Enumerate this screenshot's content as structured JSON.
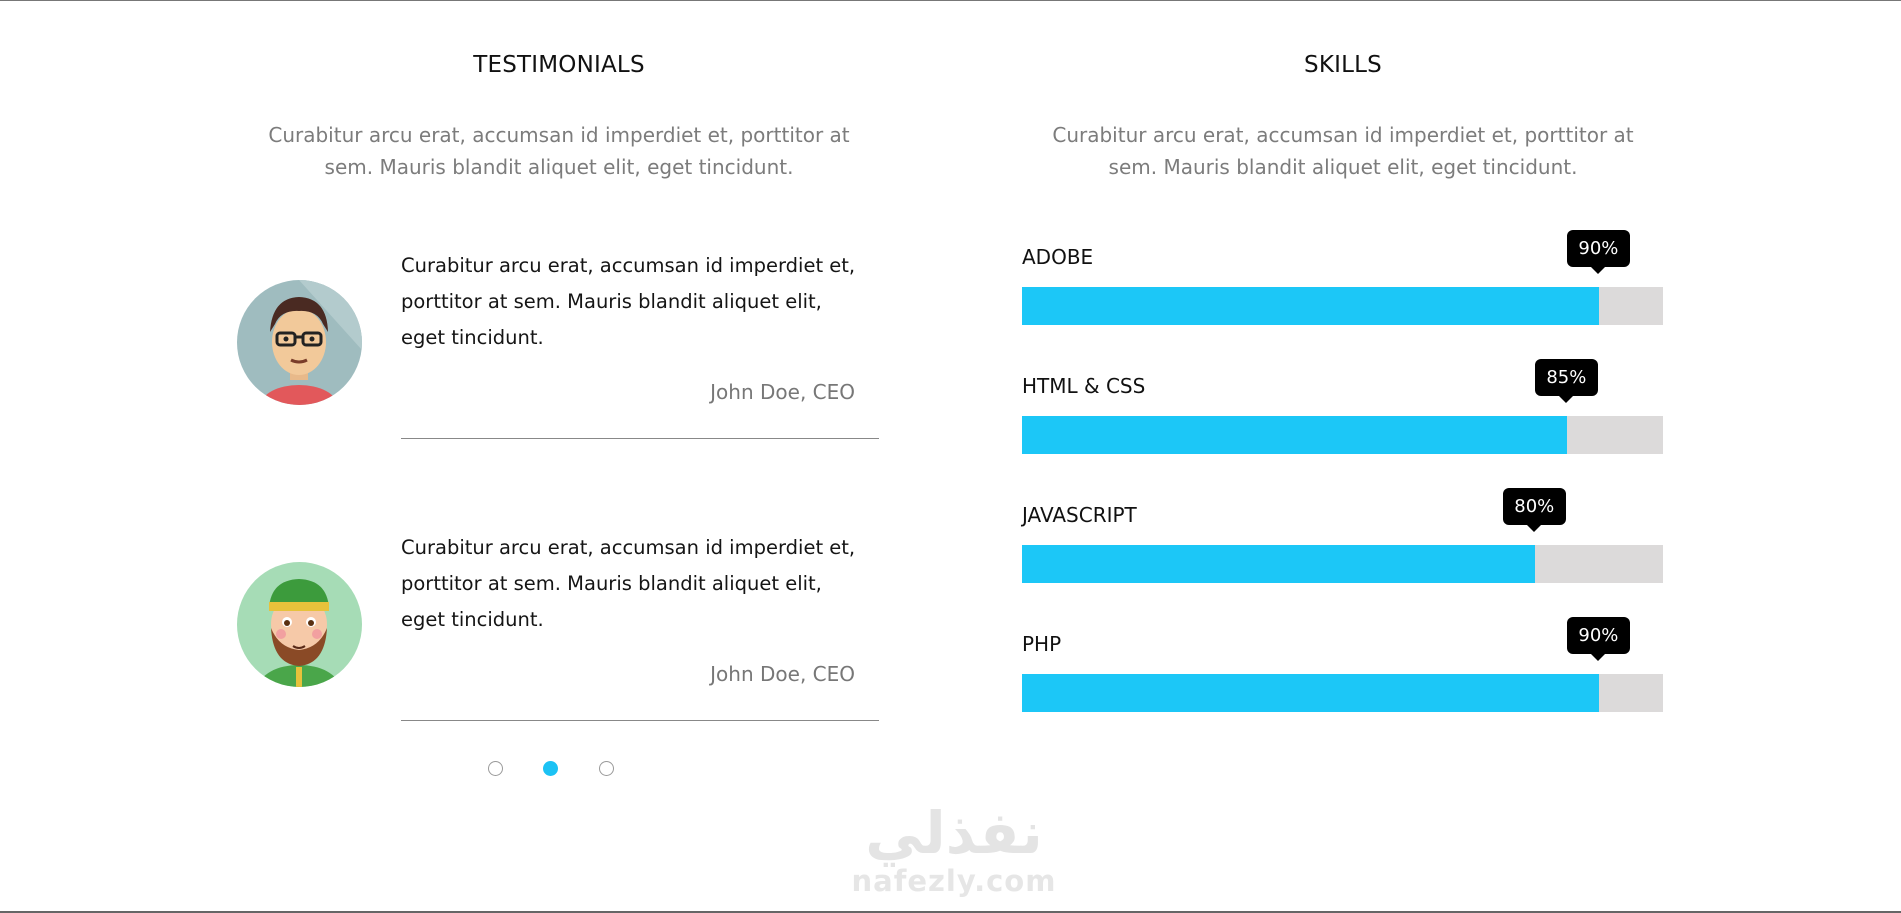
{
  "testimonials": {
    "title": "TESTIMONIALS",
    "intro": "Curabitur arcu erat, accumsan id imperdiet et, porttitor at sem. Mauris blandit aliquet elit, eget tincidunt.",
    "items": [
      {
        "quote": "Curabitur arcu erat, accumsan id imperdiet et, porttitor at sem. Mauris blandit aliquet elit, eget tincidunt.",
        "author": "John Doe, CEO",
        "avatar_icon": "man-glasses-avatar-icon"
      },
      {
        "quote": "Curabitur arcu erat, accumsan id imperdiet et, porttitor at sem. Mauris blandit aliquet elit, eget tincidunt.",
        "author": "John Doe, CEO",
        "avatar_icon": "bearded-man-avatar-icon"
      }
    ],
    "pagination": {
      "count": 3,
      "active_index": 1
    }
  },
  "skills": {
    "title": "SKILLS",
    "intro": "Curabitur arcu erat, accumsan id imperdiet et, porttitor at sem. Mauris blandit aliquet elit, eget tincidunt.",
    "items": [
      {
        "label": "ADOBE",
        "percent": 90,
        "percent_label": "90%"
      },
      {
        "label": "HTML & CSS",
        "percent": 85,
        "percent_label": "85%"
      },
      {
        "label": "JAVASCRIPT",
        "percent": 80,
        "percent_label": "80%"
      },
      {
        "label": "PHP",
        "percent": 90,
        "percent_label": "90%"
      }
    ]
  },
  "watermark": {
    "arabic": "نفذلي",
    "latin": "nafezly.com"
  },
  "colors": {
    "accent": "#1cc7f7",
    "track": "#dcdada",
    "tooltip": "#000000",
    "muted_text": "#7c7c7c"
  }
}
